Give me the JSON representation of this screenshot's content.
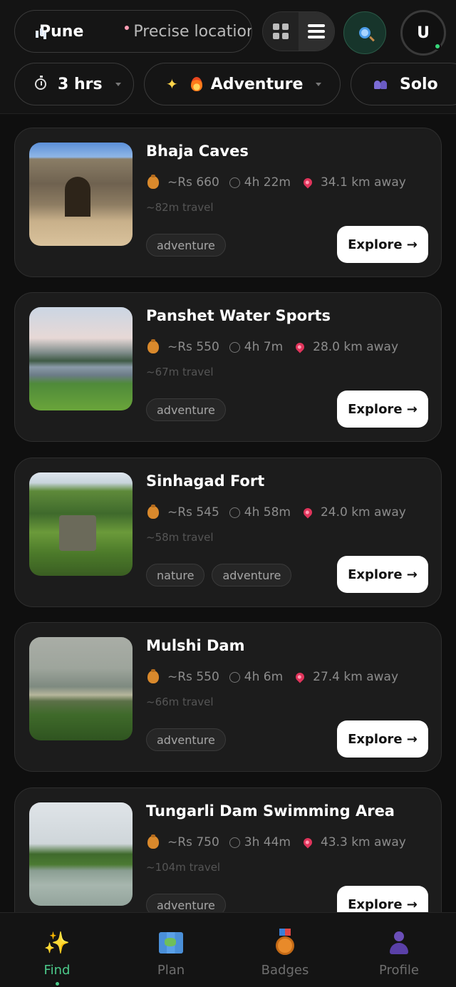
{
  "header": {
    "city": "Pune",
    "location_label": "Precise location",
    "avatar_initial": "U",
    "filters": {
      "time": "3 hrs",
      "mood": "Adventure",
      "group": "Solo"
    }
  },
  "places": [
    {
      "title": "Bhaja Caves",
      "price": "~Rs 660",
      "duration": "4h 22m",
      "distance": "34.1 km away",
      "travel": "~82m travel",
      "tags": [
        "adventure"
      ],
      "explore_label": "Explore →"
    },
    {
      "title": "Panshet Water Sports",
      "price": "~Rs 550",
      "duration": "4h 7m",
      "distance": "28.0 km away",
      "travel": "~67m travel",
      "tags": [
        "adventure"
      ],
      "explore_label": "Explore →"
    },
    {
      "title": "Sinhagad Fort",
      "price": "~Rs 545",
      "duration": "4h 58m",
      "distance": "24.0 km away",
      "travel": "~58m travel",
      "tags": [
        "nature",
        "adventure"
      ],
      "explore_label": "Explore →"
    },
    {
      "title": "Mulshi Dam",
      "price": "~Rs 550",
      "duration": "4h 6m",
      "distance": "27.4 km away",
      "travel": "~66m travel",
      "tags": [
        "adventure"
      ],
      "explore_label": "Explore →"
    },
    {
      "title": "Tungarli Dam Swimming Area",
      "price": "~Rs 750",
      "duration": "3h 44m",
      "distance": "43.3 km away",
      "travel": "~104m travel",
      "tags": [
        "adventure"
      ],
      "explore_label": "Explore →"
    }
  ],
  "nav": {
    "find": "Find",
    "plan": "Plan",
    "badges": "Badges",
    "profile": "Profile"
  },
  "colors": {
    "accent": "#4cc98a",
    "background": "#0f0f0f",
    "card": "#1c1c1c"
  },
  "icons": {
    "city": "cityscape-icon",
    "location": "pin-icon",
    "grid": "grid-view-icon",
    "list": "list-view-icon",
    "search": "search-icon",
    "time": "stopwatch-icon",
    "mood": "sparkles-icon",
    "fire": "fire-icon",
    "group": "people-icon",
    "price": "money-bag-icon",
    "duration": "stopwatch-icon"
  }
}
